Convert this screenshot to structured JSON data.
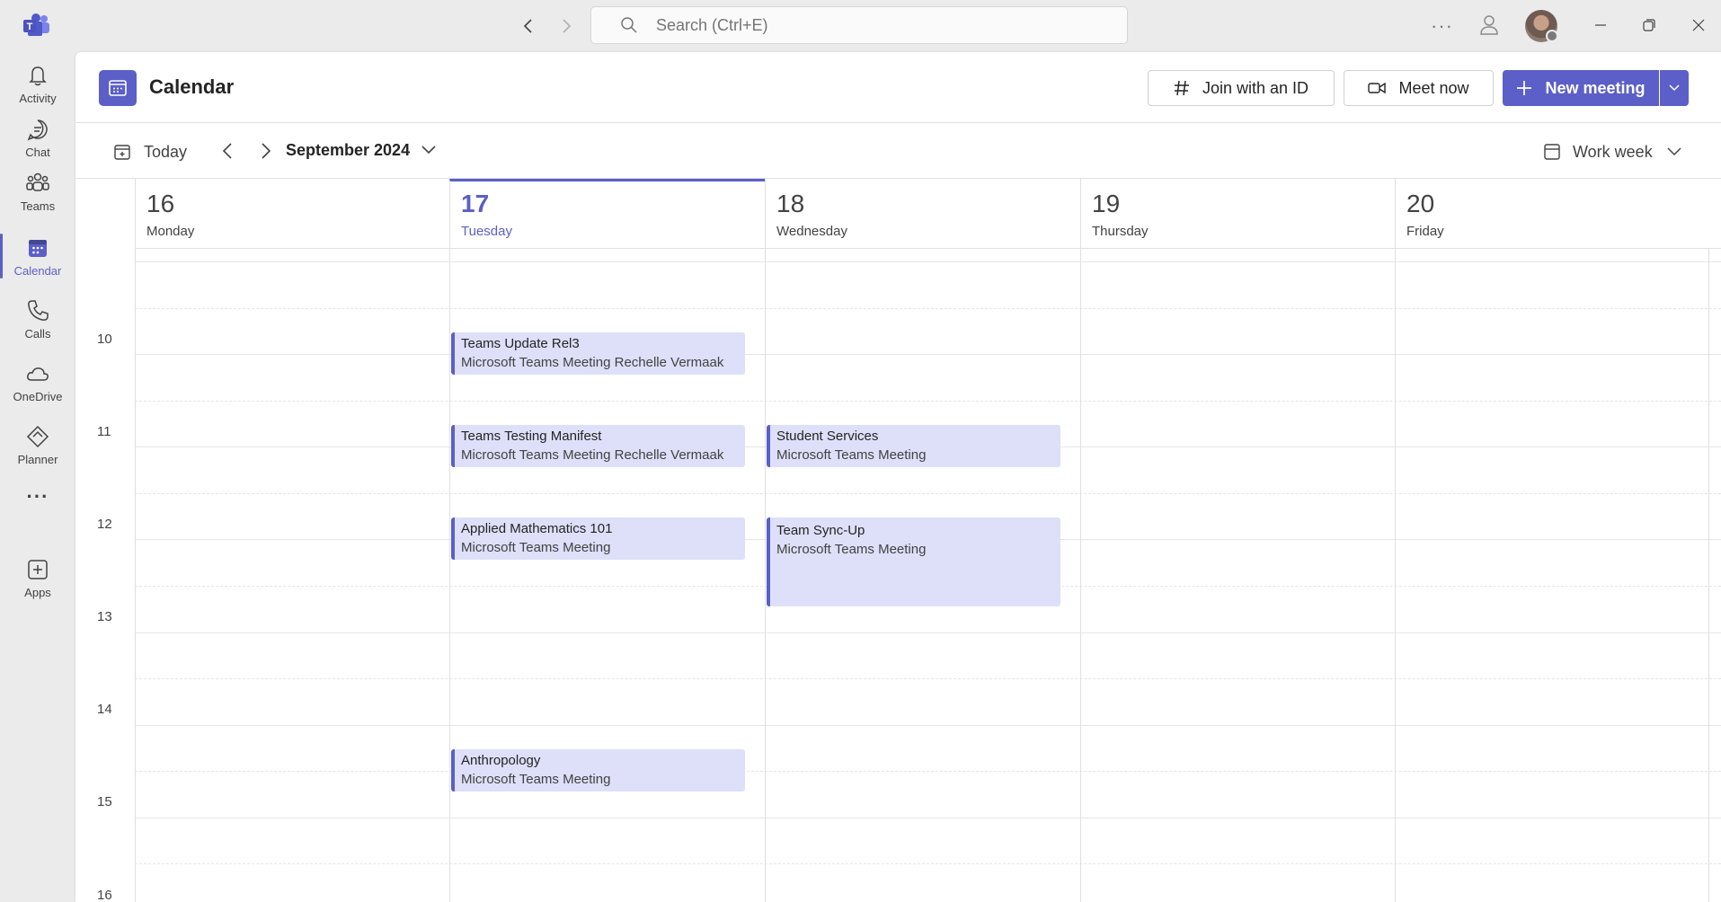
{
  "titlebar": {
    "search_placeholder": "Search (Ctrl+E)",
    "more_label": "···"
  },
  "rail": {
    "items": [
      {
        "label": "Activity",
        "icon": "bell-icon"
      },
      {
        "label": "Chat",
        "icon": "chat-icon"
      },
      {
        "label": "Teams",
        "icon": "teams-icon"
      },
      {
        "label": "Calendar",
        "icon": "calendar-icon",
        "active": true
      },
      {
        "label": "Calls",
        "icon": "phone-icon"
      },
      {
        "label": "OneDrive",
        "icon": "cloud-icon"
      },
      {
        "label": "Planner",
        "icon": "planner-icon"
      },
      {
        "label": "···",
        "icon": "more-icon"
      },
      {
        "label": "Apps",
        "icon": "apps-icon"
      }
    ]
  },
  "header": {
    "title": "Calendar",
    "join_label": "Join with an ID",
    "meet_label": "Meet now",
    "new_label": "New meeting"
  },
  "toolbar": {
    "today_label": "Today",
    "month_label": "September 2024",
    "view_label": "Work week"
  },
  "days": [
    {
      "num": "16",
      "name": "Monday"
    },
    {
      "num": "17",
      "name": "Tuesday",
      "today": true
    },
    {
      "num": "18",
      "name": "Wednesday"
    },
    {
      "num": "19",
      "name": "Thursday"
    },
    {
      "num": "20",
      "name": "Friday"
    }
  ],
  "hours": [
    "10",
    "11",
    "12",
    "13",
    "14",
    "15",
    "16"
  ],
  "events": [
    {
      "title": "Teams Update Rel3",
      "subtitle": "Microsoft Teams Meeting  Rechelle Vermaak"
    },
    {
      "title": "Teams Testing Manifest",
      "subtitle": "Microsoft Teams Meeting  Rechelle Vermaak"
    },
    {
      "title": "Applied Mathematics 101",
      "subtitle": "Microsoft Teams Meeting"
    },
    {
      "title": "Anthropology",
      "subtitle": "Microsoft Teams Meeting"
    },
    {
      "title": "Student Services",
      "subtitle": "Microsoft Teams Meeting"
    },
    {
      "title": "Team Sync-Up",
      "subtitle": "Microsoft Teams Meeting"
    }
  ],
  "colors": {
    "accent": "#5b5fc7",
    "event_bg": "#dde0f8"
  }
}
